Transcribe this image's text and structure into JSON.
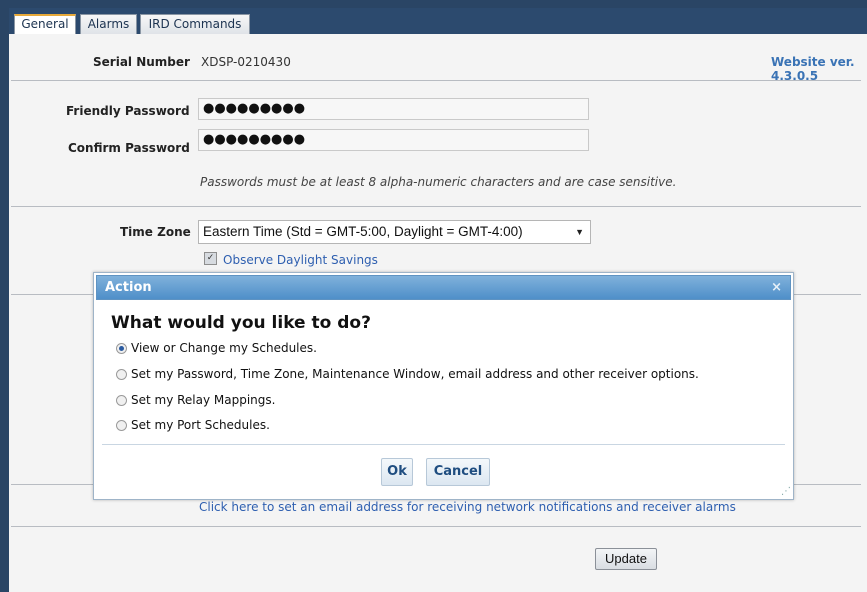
{
  "tabs": [
    "General",
    "Alarms",
    "IRD Commands"
  ],
  "general": {
    "serial_label": "Serial Number",
    "serial_value": "XDSP-0210430",
    "website_version": "Website ver. 4.3.0.5",
    "friendly_password_label": "Friendly Password",
    "friendly_password_value": "●●●●●●●●●",
    "confirm_password_label": "Confirm Password",
    "confirm_password_value": "●●●●●●●●●",
    "password_hint": "Passwords must be at least 8 alpha-numeric characters and are case sensitive.",
    "timezone_label": "Time Zone",
    "timezone_value": "Eastern Time (Std = GMT-5:00, Daylight = GMT-4:00)",
    "dst_label": "Observe Daylight Savings",
    "dst_checked": true,
    "email_link": "Click here to set an email address for receiving network notifications and receiver alarms",
    "update_label": "Update"
  },
  "dialog": {
    "title": "Action",
    "close_glyph": "×",
    "heading": "What would you like to do?",
    "options": [
      {
        "label": "View or Change my Schedules.",
        "selected": true
      },
      {
        "label": "Set my Password, Time Zone, Maintenance Window, email address and other receiver options.",
        "selected": false
      },
      {
        "label": "Set my Relay Mappings.",
        "selected": false
      },
      {
        "label": "Set my Port Schedules.",
        "selected": false
      }
    ],
    "ok_label": "Ok",
    "cancel_label": "Cancel"
  },
  "colors": {
    "frame": "#2c4a6e",
    "active_tab_accent": "#e7a93a",
    "dialog_title": "#4f8fc9",
    "link": "#2e5fb0"
  }
}
